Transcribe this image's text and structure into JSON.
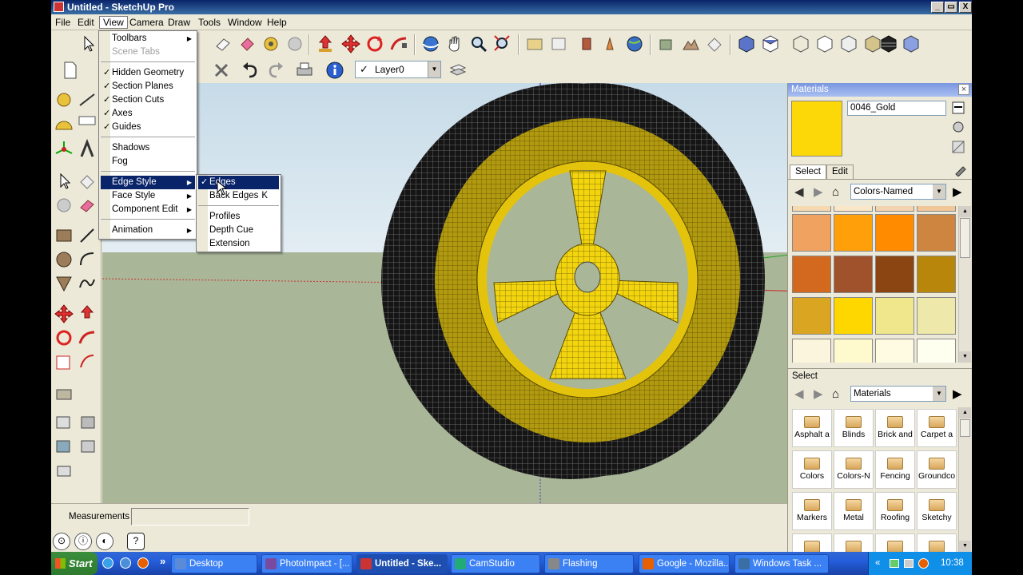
{
  "window": {
    "title": "Untitled - SketchUp Pro",
    "controls": [
      "_",
      "▭",
      "X"
    ]
  },
  "menubar": [
    "File",
    "Edit",
    "View",
    "Camera",
    "Draw",
    "Tools",
    "Window",
    "Help"
  ],
  "view_menu": {
    "items": [
      {
        "label": "Toolbars",
        "checked": false,
        "submenu": true,
        "disabled": false
      },
      {
        "label": "Scene Tabs",
        "checked": false,
        "submenu": false,
        "disabled": true
      },
      {
        "label": "Hidden Geometry",
        "checked": true
      },
      {
        "label": "Section Planes",
        "checked": true
      },
      {
        "label": "Section Cuts",
        "checked": true
      },
      {
        "label": "Axes",
        "checked": true
      },
      {
        "label": "Guides",
        "checked": true
      },
      {
        "label": "Shadows",
        "checked": false
      },
      {
        "label": "Fog",
        "checked": false
      },
      {
        "label": "Edge Style",
        "submenu": true,
        "highlighted": true
      },
      {
        "label": "Face Style",
        "submenu": true
      },
      {
        "label": "Component Edit",
        "submenu": true
      },
      {
        "label": "Animation",
        "submenu": true
      }
    ]
  },
  "edge_style_menu": {
    "items": [
      {
        "label": "Edges",
        "checked": true,
        "highlighted": true
      },
      {
        "label": "Back Edges",
        "shortcut": "K"
      },
      {
        "label": "Profiles"
      },
      {
        "label": "Depth Cue"
      },
      {
        "label": "Extension"
      }
    ]
  },
  "layer": {
    "current": "Layer0"
  },
  "measurements": {
    "label": "Measurements",
    "value": ""
  },
  "materials": {
    "title": "Materials",
    "current_name": "0046_Gold",
    "current_color": "#fdd808",
    "tabs": [
      "Select",
      "Edit"
    ],
    "library": "Colors-Named",
    "swatches": [
      "#f6d9b0",
      "#f9e7c8",
      "#f3d3b0",
      "#f1c79a",
      "#f0a260",
      "#ff9f0a",
      "#ff8c00",
      "#cd853f",
      "#d2691e",
      "#a0522d",
      "#8b4513",
      "#b8860b",
      "#daa520",
      "#ffd700",
      "#f0e68c",
      "#eee8aa",
      "#faf5dc",
      "#fffacd",
      "#fffbe2",
      "#fffff0"
    ],
    "select_title": "Select",
    "lower_library": "Materials",
    "folders": [
      "Asphalt a",
      "Blinds",
      "Brick and",
      "Carpet a",
      "Colors",
      "Colors-N",
      "Fencing",
      "Groundco",
      "Markers",
      "Metal",
      "Roofing",
      "Sketchy"
    ]
  },
  "taskbar": {
    "start": "Start",
    "tasks": [
      {
        "label": "Desktop",
        "color": "#5b8ad8"
      },
      {
        "label": "PhotoImpact - [...",
        "color": "#7a4aa0"
      },
      {
        "label": "Untitled - Ske...",
        "color": "#c33",
        "active": true
      },
      {
        "label": "CamStudio",
        "color": "#2a7"
      },
      {
        "label": "Flashing",
        "color": "#888"
      },
      {
        "label": "Google - Mozilla...",
        "color": "#e66000"
      },
      {
        "label": "Windows Task ...",
        "color": "#3a6ea5"
      }
    ],
    "clock": "10:38",
    "more": "»",
    "tray_more": "«"
  }
}
